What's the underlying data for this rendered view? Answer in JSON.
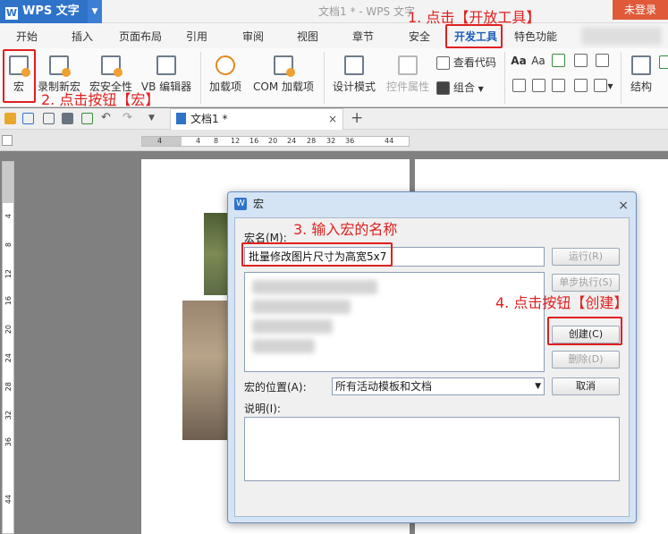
{
  "titlebar": {
    "app_name": "WPS 文字",
    "app_logo": "W",
    "doc_title": "文档1 * - WPS 文字",
    "login": "未登录"
  },
  "menu": {
    "tabs": [
      "开始",
      "插入",
      "页面布局",
      "引用",
      "审阅",
      "视图",
      "章节",
      "安全",
      "开发工具",
      "特色功能"
    ],
    "active": "开发工具"
  },
  "ribbon": {
    "macro": "宏",
    "record_macro": "录制新宏",
    "macro_security": "宏安全性",
    "vb_editor": "VB 编辑器",
    "addins": "加载项",
    "com_addins": "COM 加载项",
    "design_mode": "设计模式",
    "control_props": "控件属性",
    "view_code": "查看代码",
    "group": "组合",
    "structure": "结构",
    "font_a1": "Aa",
    "font_a2": "Aa"
  },
  "doc_tab": {
    "label": "文档1 *",
    "close": "×",
    "new": "+"
  },
  "ruler": {
    "h_numbers": [
      "4",
      "4",
      "8",
      "12",
      "16",
      "20",
      "24",
      "28",
      "32",
      "36",
      "44"
    ],
    "v_numbers": [
      "4",
      "8",
      "12",
      "16",
      "20",
      "24",
      "28",
      "32",
      "36",
      "44"
    ]
  },
  "dialog": {
    "title": "宏",
    "logo": "W",
    "close": "×",
    "macro_name_label": "宏名(M):",
    "macro_name_value": "批量修改图片尺寸为高宽5x7",
    "run": "运行(R)",
    "step": "单步执行(S)",
    "create": "创建(C)",
    "delete": "删除(D)",
    "location_label": "宏的位置(A):",
    "location_value": "所有活动模板和文档",
    "cancel": "取消",
    "desc_label": "说明(I):"
  },
  "annotations": {
    "step1": "1. 点击【开放工具】",
    "step2": "2. 点击按钮【宏】",
    "step3": "3. 输入宏的名称",
    "step4": "4. 点击按钮【创建】"
  },
  "colors": {
    "annotation": "#e02020",
    "brand": "#2f73c9",
    "login": "#e05a3a"
  }
}
